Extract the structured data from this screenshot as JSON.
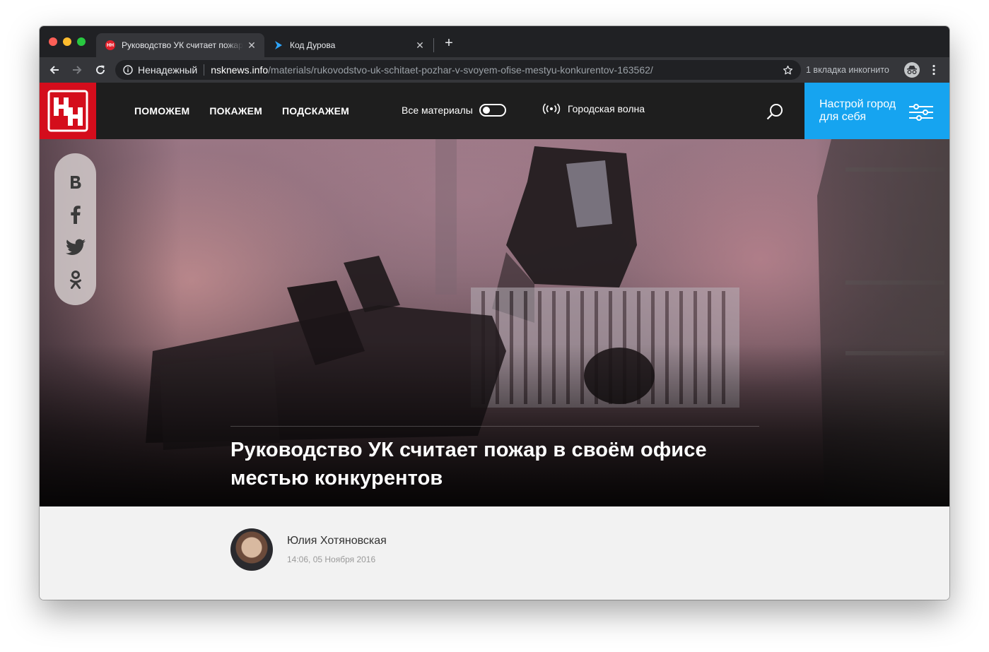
{
  "browser": {
    "tabs": [
      {
        "title": "Руководство УК считает пожар в своём офисе",
        "favicon": "nn-favicon-icon",
        "active": true
      },
      {
        "title": "Код Дурова",
        "favicon": "durov-code-favicon-icon",
        "active": false
      }
    ],
    "new_tab_label": "+",
    "security_label": "Ненадежный",
    "url_host": "nsknews.info",
    "url_path": "/materials/rukovodstvo-uk-schitaet-pozhar-v-svoyem-ofise-mestyu-konkurentov-163562/",
    "incognito_label": "1 вкладка инкогнито"
  },
  "site": {
    "logo_alt": "НН",
    "nav": [
      "ПОМОЖЕМ",
      "ПОКАЖЕМ",
      "ПОДСКАЖЕМ"
    ],
    "all_materials_label": "Все материалы",
    "radio_label": "Городская волна",
    "city_button_label": "Настрой город для себя",
    "brand_color": "#d40d1c",
    "accent_color": "#16a4f0"
  },
  "article": {
    "title": "Руководство УК считает пожар в своём офисе местью конкурентов",
    "author": "Юлия Хотяновская",
    "date": "14:06, 05 Ноября 2016"
  },
  "share": [
    "vk-icon",
    "facebook-icon",
    "twitter-icon",
    "odnoklassniki-icon"
  ]
}
